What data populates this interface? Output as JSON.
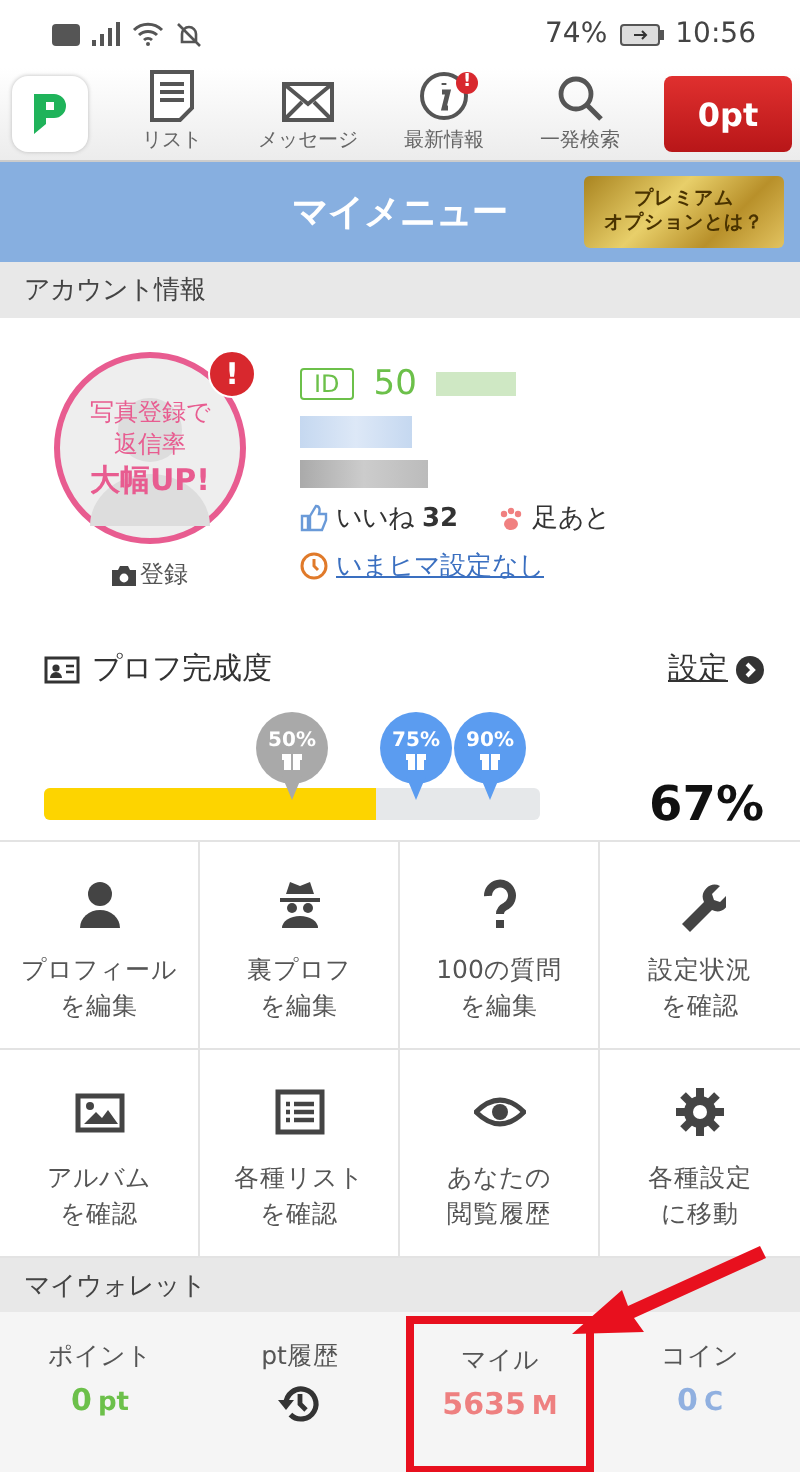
{
  "status_bar": {
    "battery": "74%",
    "time": "10:56"
  },
  "toolbar": {
    "items": [
      {
        "kind": "list",
        "label": "リスト",
        "badge": false
      },
      {
        "kind": "mail",
        "label": "メッセージ",
        "badge": false
      },
      {
        "kind": "info",
        "label": "最新情報",
        "badge": true
      },
      {
        "kind": "search",
        "label": "一発検索",
        "badge": false
      }
    ],
    "points_button": "0pt"
  },
  "header": {
    "title": "マイメニュー",
    "premium_button": [
      "プレミアム",
      "オプションとは？"
    ]
  },
  "account": {
    "section_title": "アカウント情報",
    "photo_prompt": [
      "写真登録で",
      "返信率",
      "大幅UP!"
    ],
    "alert": "!",
    "register_label": "登録",
    "id_label": "ID",
    "id_value": "50",
    "likes_label": "いいね",
    "likes_count": "32",
    "footprints": "足あと",
    "status_link": "いまヒマ設定なし"
  },
  "profile_completion": {
    "title": "プロフ完成度",
    "settings_link": "設定",
    "level": 0.67,
    "percent": "67%",
    "milestones": [
      {
        "label": "50%",
        "reached": true
      },
      {
        "label": "75%",
        "reached": false
      },
      {
        "label": "90%",
        "reached": false
      }
    ]
  },
  "menu_grid": [
    {
      "kind": "person",
      "label": [
        "プロフィール",
        "を編集"
      ]
    },
    {
      "kind": "spy",
      "label": [
        "裏プロフ",
        "を編集"
      ]
    },
    {
      "kind": "question",
      "label": [
        "100の質問",
        "を編集"
      ]
    },
    {
      "kind": "wrench",
      "label": [
        "設定状況",
        "を確認"
      ]
    },
    {
      "kind": "image",
      "label": [
        "アルバム",
        "を確認"
      ]
    },
    {
      "kind": "list",
      "label": [
        "各種リスト",
        "を確認"
      ]
    },
    {
      "kind": "eye",
      "label": [
        "あなたの",
        "閲覧履歴"
      ]
    },
    {
      "kind": "gear",
      "label": [
        "各種設定",
        "に移動"
      ]
    }
  ],
  "wallet": {
    "section_title": "マイウォレット",
    "items": [
      {
        "kind": "value",
        "label": "ポイント",
        "value": "0",
        "unit": "pt",
        "color": "#6cc04a",
        "highlighted": false
      },
      {
        "kind": "history",
        "label": "pt履歴",
        "highlighted": false
      },
      {
        "kind": "value",
        "label": "マイル",
        "value": "5635",
        "unit": "M",
        "color": "#ee8080",
        "highlighted": true
      },
      {
        "kind": "value",
        "label": "コイン",
        "value": "0",
        "unit": "C",
        "color": "#90b0e0",
        "highlighted": false
      }
    ]
  }
}
